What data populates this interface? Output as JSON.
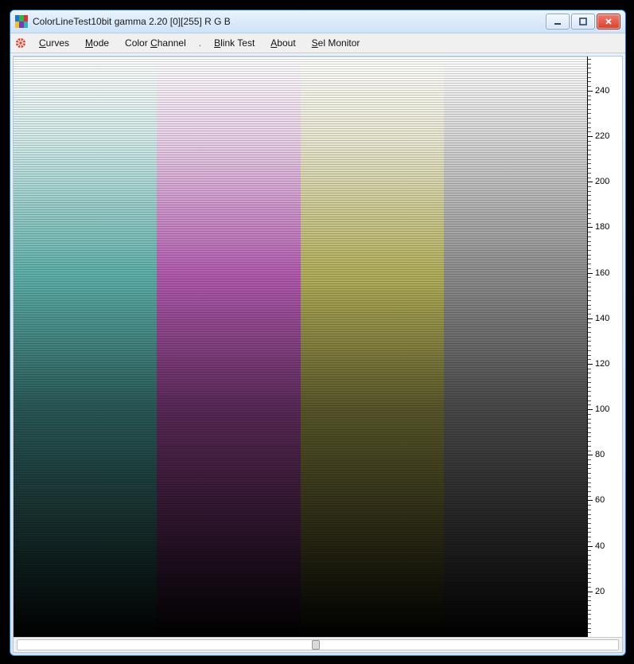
{
  "window": {
    "title": "ColorLineTest10bit gamma 2.20 [0][255]   R G B"
  },
  "menu": {
    "items": [
      {
        "label": "Curves",
        "mnemonic_index": 0
      },
      {
        "label": "Mode",
        "mnemonic_index": 0
      },
      {
        "label": "Color Channel",
        "mnemonic_index": 6
      },
      {
        "label": "Blink Test",
        "mnemonic_index": 0
      },
      {
        "label": "About",
        "mnemonic_index": 0
      },
      {
        "label": "Sel Monitor",
        "mnemonic_index": 0
      }
    ],
    "separator": "."
  },
  "chart_data": {
    "type": "heatmap",
    "title": "",
    "xlabel": "",
    "ylabel": "",
    "ylim": [
      0,
      255
    ],
    "y_ticks_major": [
      20,
      40,
      60,
      80,
      100,
      120,
      140,
      160,
      180,
      200,
      220,
      240
    ],
    "y_ticks_minor_step": 2,
    "columns": [
      {
        "name": "cyan",
        "rgb_low": "#000000",
        "rgb_mid": "#5dafa9",
        "rgb_high": "#ffffff"
      },
      {
        "name": "magenta",
        "rgb_low": "#000000",
        "rgb_mid": "#b25aae",
        "rgb_high": "#ffffff"
      },
      {
        "name": "yellow",
        "rgb_low": "#000000",
        "rgb_mid": "#b2ae5a",
        "rgb_high": "#ffffff"
      },
      {
        "name": "gray",
        "rgb_low": "#000000",
        "rgb_mid": "#8c8c8c",
        "rgb_high": "#ffffff"
      }
    ],
    "gamma": 2.2,
    "range": [
      0,
      255
    ],
    "channels": "R G B"
  },
  "scrollbar": {
    "position_fraction": 0.49
  }
}
